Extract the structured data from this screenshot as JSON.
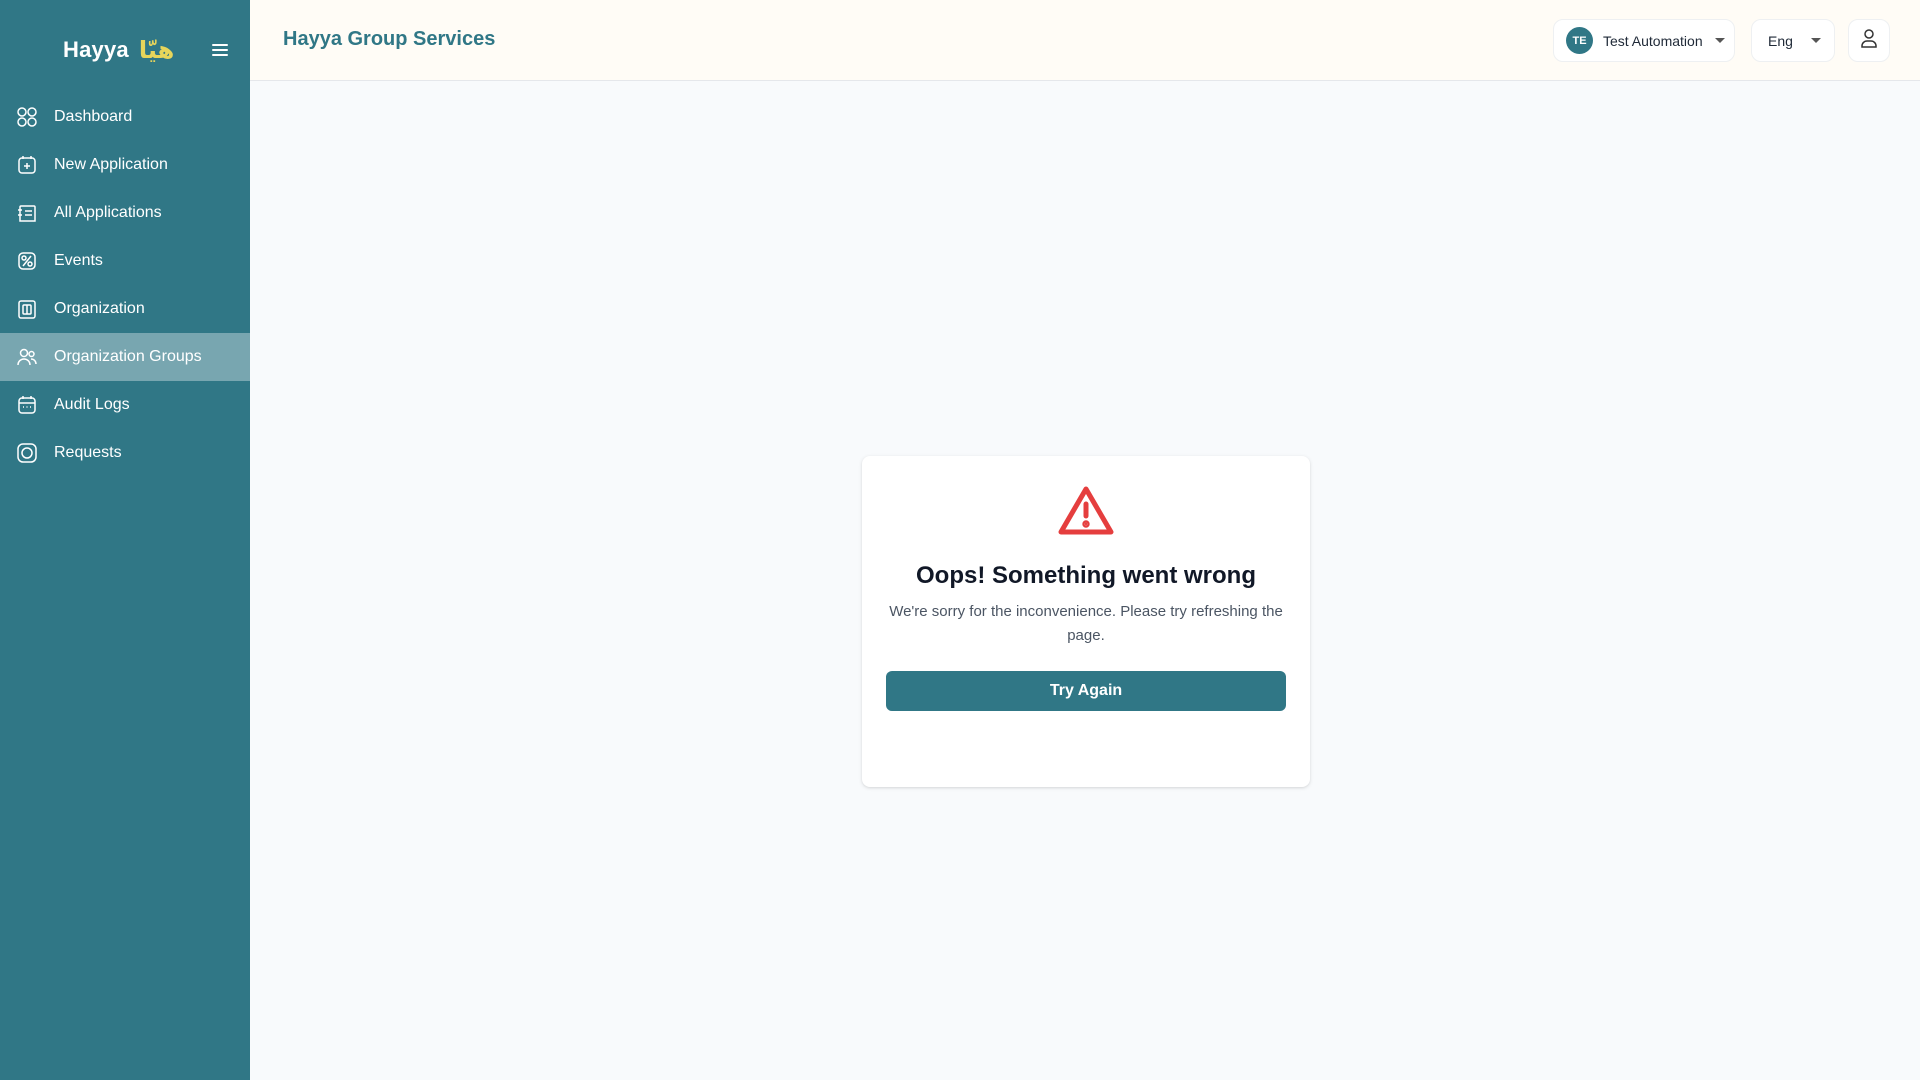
{
  "brand": {
    "name_en": "Hayya",
    "name_ar": "هيّا",
    "accent": "#307786",
    "logo_accent": "#e7d55b"
  },
  "sidebar": {
    "items": [
      {
        "label": "Dashboard",
        "icon": "dashboard-grid-icon",
        "active": false
      },
      {
        "label": "New Application",
        "icon": "new-application-icon",
        "active": false
      },
      {
        "label": "All Applications",
        "icon": "all-applications-icon",
        "active": false
      },
      {
        "label": "Events",
        "icon": "events-icon",
        "active": false
      },
      {
        "label": "Organization",
        "icon": "organization-icon",
        "active": false
      },
      {
        "label": "Organization Groups",
        "icon": "organization-groups-icon",
        "active": true
      },
      {
        "label": "Audit Logs",
        "icon": "audit-logs-icon",
        "active": false
      },
      {
        "label": "Requests",
        "icon": "requests-icon",
        "active": false
      }
    ]
  },
  "header": {
    "title": "Hayya Group Services",
    "user": {
      "initials": "TE",
      "name": "Test Automation"
    },
    "language": "Eng"
  },
  "error": {
    "title": "Oops! Something went wrong",
    "message": "We're sorry for the inconvenience. Please try refreshing the page.",
    "button": "Try Again",
    "icon": "warning-triangle-icon",
    "icon_color": "#e53e3e"
  }
}
